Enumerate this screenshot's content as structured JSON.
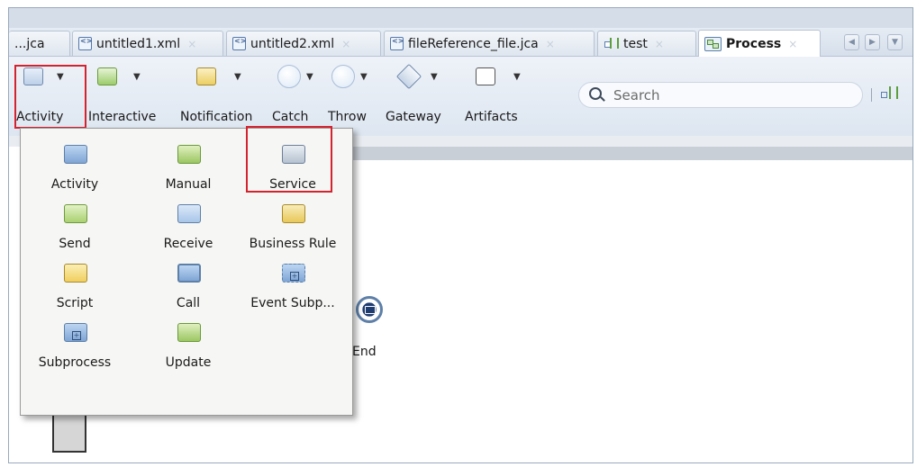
{
  "tabs": [
    {
      "label": "...jca"
    },
    {
      "label": "untitled1.xml",
      "close": "×"
    },
    {
      "label": "untitled2.xml",
      "close": "×"
    },
    {
      "label": "fileReference_file.jca",
      "close": "×"
    },
    {
      "label": "test",
      "close": "×"
    },
    {
      "label": "Process",
      "close": "×"
    }
  ],
  "toolbar": {
    "activity": "Activity",
    "interactive": "Interactive",
    "notification": "Notification",
    "catch": "Catch",
    "throw": "Throw",
    "gateway": "Gateway",
    "artifacts": "Artifacts",
    "dropdown_arrow": "▼"
  },
  "search": {
    "placeholder": "Search"
  },
  "palette": {
    "activity": "Activity",
    "manual": "Manual",
    "service": "Service",
    "send": "Send",
    "receive": "Receive",
    "business_rule": "Business Rule",
    "script": "Script",
    "call": "Call",
    "event_subprocess": "Event Subp...",
    "subprocess": "Subprocess",
    "update": "Update"
  },
  "canvas": {
    "end_label": "End"
  },
  "colors": {
    "highlight": "#d3232f",
    "toolbar_bg": "#dde6f1"
  }
}
